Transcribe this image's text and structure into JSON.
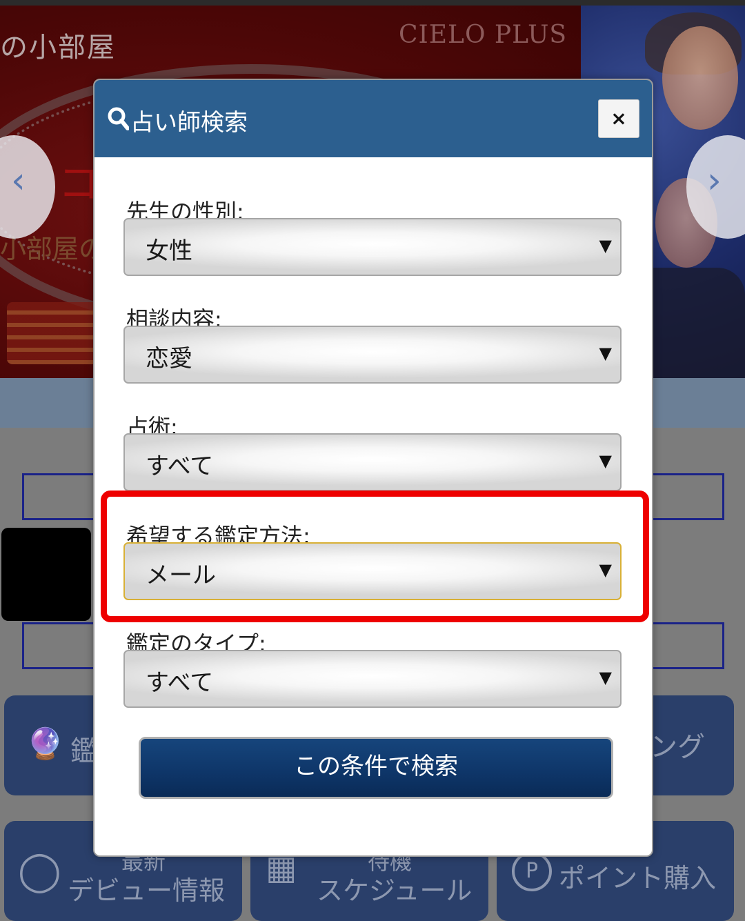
{
  "background": {
    "banner_title": "の小部屋",
    "banner_brand": "CIELO PLUS",
    "banner_sub": "小部屋の",
    "banner_red_char": "コ",
    "nav_prev_icon": "chevron-left-icon",
    "nav_next_icon": "chevron-right-icon",
    "buttons": [
      {
        "label": "鑑"
      },
      {
        "label": "ング"
      },
      {
        "line1": "最新",
        "line2": "デビュー情報"
      },
      {
        "line1": "待機",
        "line2": "スケジュール"
      },
      {
        "label": "ポイント購入",
        "icon_text": "P"
      }
    ]
  },
  "modal": {
    "title": "占い師検索",
    "close_label": "×",
    "fields": [
      {
        "label": "先生の性別:",
        "value": "女性"
      },
      {
        "label": "相談内容:",
        "value": "恋愛"
      },
      {
        "label": "占術:",
        "value": "すべて"
      },
      {
        "label": "希望する鑑定方法:",
        "value": "メール"
      },
      {
        "label": "鑑定のタイプ:",
        "value": "すべて"
      }
    ],
    "arrow": "▼",
    "search_button_label": "この条件で検索"
  },
  "colors": {
    "header": "#2c5f8f",
    "highlight": "#ee0000",
    "search_button": "#0e3568",
    "focus_border": "#d8b036"
  }
}
